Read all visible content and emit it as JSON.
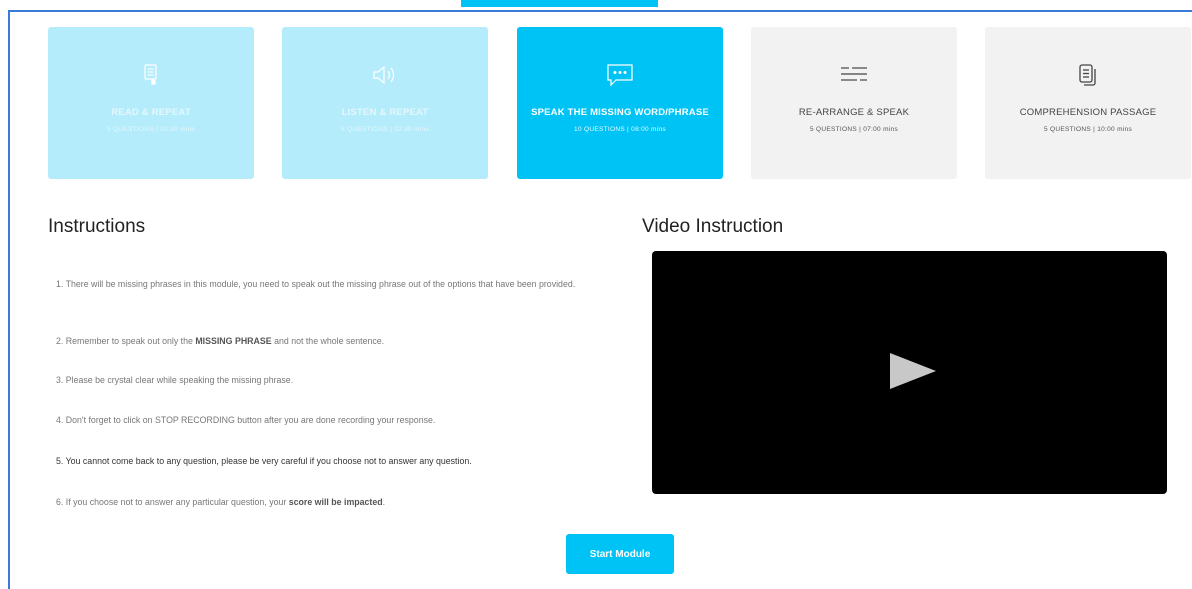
{
  "modules": [
    {
      "title": "READ & REPEAT",
      "meta": "5 QUESTIONS | 02:30 mins",
      "icon": "hand-document-icon",
      "state": "faded"
    },
    {
      "title": "LISTEN & REPEAT",
      "meta": "5 QUESTIONS | 02:30 mins",
      "icon": "speaker-icon",
      "state": "faded"
    },
    {
      "title": "SPEAK THE MISSING WORD/PHRASE",
      "meta": "10 QUESTIONS | 08:00 mins",
      "icon": "chat-bubble-icon",
      "state": "active"
    },
    {
      "title": "RE-ARRANGE & SPEAK",
      "meta": "5 QUESTIONS | 07:00 mins",
      "icon": "rearrange-lines-icon",
      "state": "inactive"
    },
    {
      "title": "COMPREHENSION PASSAGE",
      "meta": "5 QUESTIONS | 10:00 mins",
      "icon": "document-icon",
      "state": "inactive"
    }
  ],
  "instructions": {
    "heading": "Instructions",
    "items": [
      {
        "pre": "1. There will be missing phrases in this module, you need to speak out the missing phrase out of the options that have been provided.",
        "bold": "",
        "post": ""
      },
      {
        "pre": "2. Remember to speak out only the ",
        "bold": "MISSING PHRASE",
        "post": " and not the whole sentence."
      },
      {
        "pre": "3. Please be crystal clear while speaking the missing phrase.",
        "bold": "",
        "post": ""
      },
      {
        "pre": "4. Don't forget to click on STOP RECORDING button after you are done recording your response.",
        "bold": "",
        "post": ""
      },
      {
        "pre": "5. You cannot come back to any question, please be very careful if you choose not to answer any question.",
        "bold": "",
        "post": ""
      },
      {
        "pre": "6. If you choose not to answer any particular question, your ",
        "bold": "score will be impacted",
        "post": "."
      }
    ]
  },
  "video": {
    "heading": "Video Instruction"
  },
  "start_button": {
    "label": "Start Module"
  },
  "colors": {
    "accent": "#00c3f5",
    "faded": "#b4ecfb",
    "inactive": "#f2f2f2",
    "frame": "#3a7bd5"
  }
}
